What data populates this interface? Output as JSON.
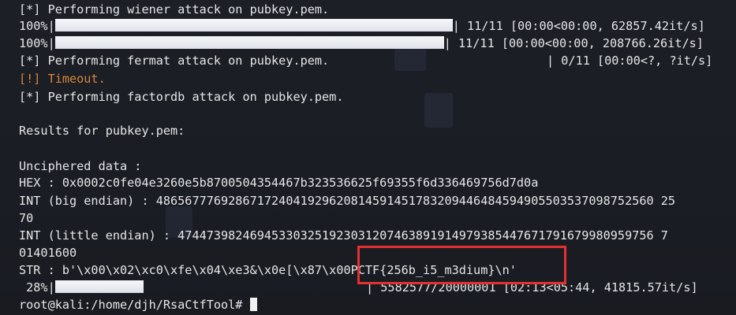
{
  "lines": {
    "l1": "[*] Performing wiener attack on pubkey.pem.",
    "l2_pct": "100%|",
    "l2_tail": "| 11/11 [00:00<00:00, 62857.42it/s]",
    "l3_pct": "100%|",
    "l3_tail": "| 11/11 [00:00<00:00, 208766.26it/s]",
    "l4": "[*] Performing fermat attack on pubkey.pem.",
    "l4_tail": "| 0/11 [00:00<?, ?it/s]",
    "l5": "[!] Timeout.",
    "l6": "[*] Performing factordb attack on pubkey.pem.",
    "l8": "Results for pubkey.pem:",
    "l10": "Unciphered data :",
    "l11": "HEX : 0x0002c0fe04e3260e5b8700504354467b323536625f69355f6d336469756d7d0a",
    "l12": "INT (big endian) : 486567776928671724041929620814591451783209446484594905503537098752560 25",
    "l13": "70",
    "l14": "INT (little endian) : 474473982469453303251923031207463891914979385447671791679980959756 7",
    "l15": "01401600",
    "l16": "STR : b'\\x00\\x02\\xc0\\xfe\\x04\\xe3&\\x0e[\\x87\\x00PCTF{256b_i5_m3dium}\\n'",
    "l17_pct": " 28%|",
    "l17_tail": "| 5582577/20000001 [02:13<05:44, 41815.57it/s]",
    "prompt": "root@kali:/home/djh/RsaCtfTool# "
  },
  "progress": {
    "wiener_1": 1.0,
    "wiener_2": 1.0,
    "fermat": 0.0,
    "bruteforce": 0.28
  },
  "colors": {
    "warning": "#d8863a",
    "highlight_box": "#e53030"
  }
}
